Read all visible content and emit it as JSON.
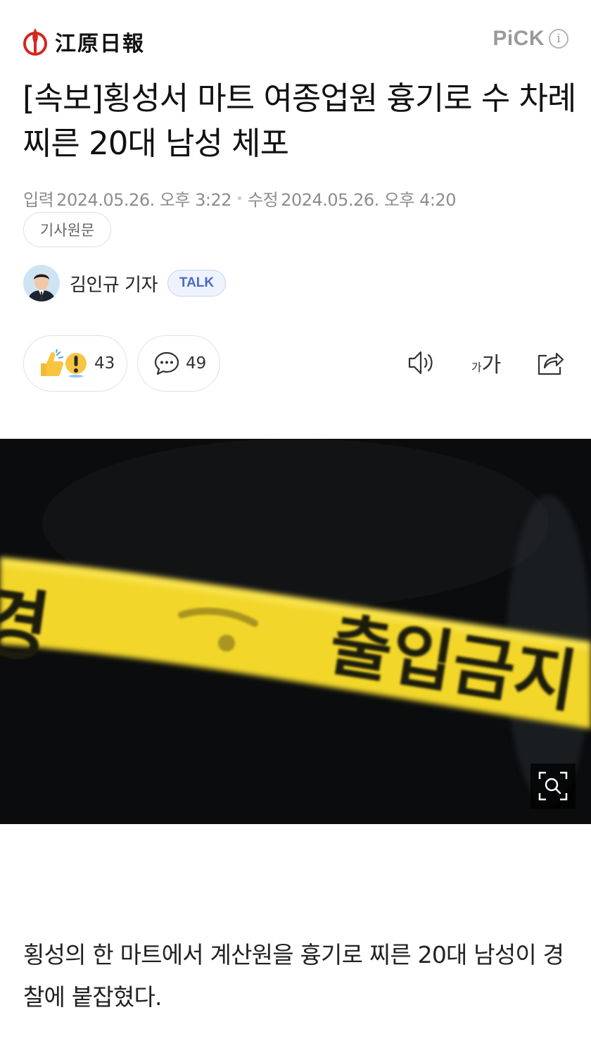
{
  "header": {
    "press_name": "江原日報",
    "pick_label": "PiCK",
    "pick_info": "i"
  },
  "article": {
    "headline": "[속보]횡성서 마트 여종업원 흉기로 수 차례 찌른 20대 남성 체포",
    "input_label": "입력",
    "input_date": "2024.05.26. 오후 3:22",
    "modified_label": "수정",
    "modified_date": "2024.05.26. 오후 4:20",
    "original_button": "기사원문",
    "reporter_name": "김인규 기자",
    "talk_label": "TALK",
    "body": "횡성의 한 마트에서 계산원을 흉기로 찌른 20대 남성이 경찰에 붙잡혔다."
  },
  "toolbar": {
    "reaction_count": "43",
    "comment_count": "49",
    "font_small": "가",
    "font_big": "가"
  },
  "photo": {
    "tape_text_main": "출입금지",
    "tape_text_left": "경",
    "tape_color": "#f2d72b",
    "background_color": "#0b0c0e"
  },
  "colors": {
    "accent_red": "#d3271f",
    "talk_blue": "#4a6ac4",
    "meta_gray": "#8d8d8d"
  },
  "icons": [
    "press-logo-icon",
    "info-icon",
    "reaction-icon",
    "comment-icon",
    "audio-icon",
    "font-size-icon",
    "share-icon",
    "zoom-icon"
  ]
}
